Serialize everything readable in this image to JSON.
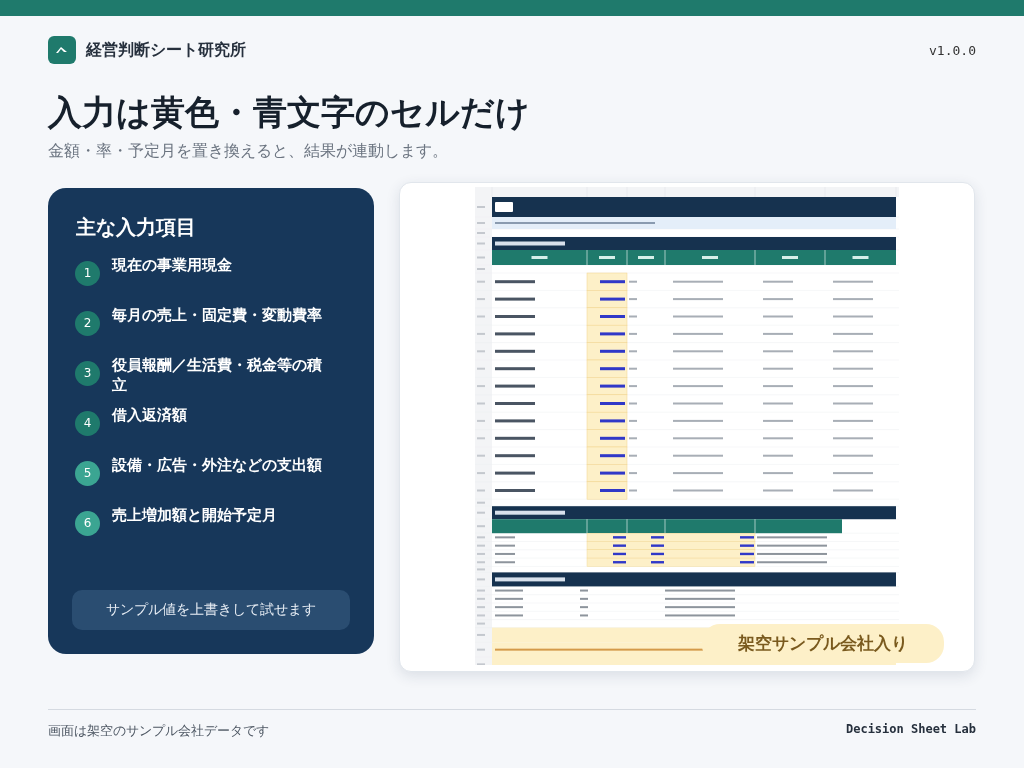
{
  "brand": {
    "name": "経営判断シート研究所",
    "version": "v1.0.0"
  },
  "title": "入力は黄色・青文字のセルだけ",
  "subtitle": "金額・率・予定月を置き換えると、結果が連動します。",
  "input_panel": {
    "heading": "主な入力項目",
    "items": [
      {
        "number": "1",
        "label": "現在の事業用現金",
        "color": "#1f7a6c"
      },
      {
        "number": "2",
        "label": "毎月の売上・固定費・変動費率",
        "color": "#1f7a6c"
      },
      {
        "number": "3",
        "label": "役員報酬／生活費・税金等の積立",
        "color": "#1f7a6c"
      },
      {
        "number": "4",
        "label": "借入返済額",
        "color": "#1f7a6c"
      },
      {
        "number": "5",
        "label": "設備・広告・外注などの支出額",
        "color": "#3ba592"
      },
      {
        "number": "6",
        "label": "売上増加額と開始予定月",
        "color": "#3ba592"
      }
    ],
    "note": "サンプル値を上書きして試せます"
  },
  "preview": {
    "badge": "架空サンプル会社入り"
  },
  "footer": {
    "note": "画面は架空のサンプル会社データです",
    "brand": "Decision Sheet Lab"
  }
}
